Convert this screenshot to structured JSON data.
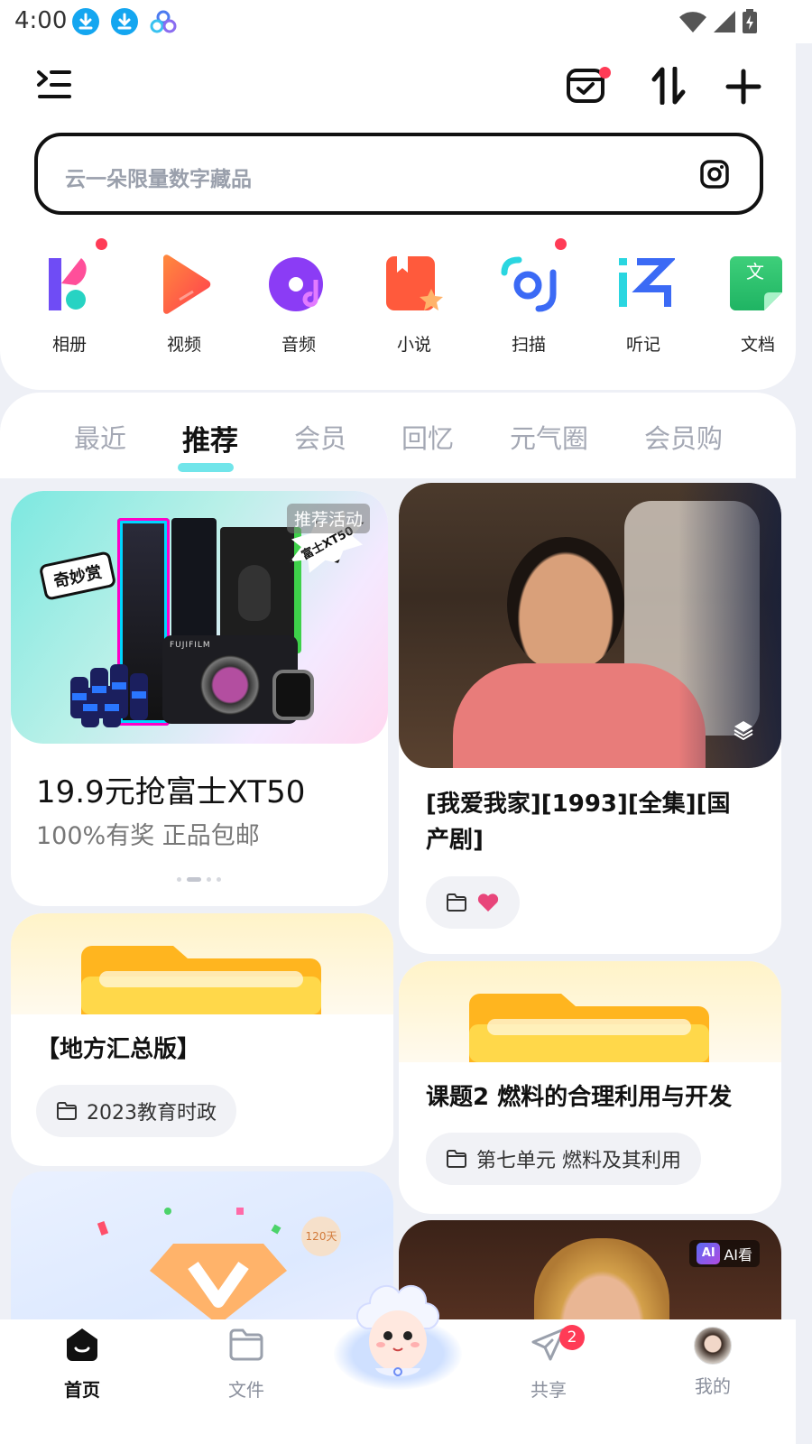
{
  "status_bar": {
    "time": "4:00"
  },
  "search": {
    "placeholder": "云一朵限量数字藏品"
  },
  "apps": [
    {
      "label": "相册",
      "icon": "photo-album-icon",
      "dot": true
    },
    {
      "label": "视频",
      "icon": "video-play-icon",
      "dot": false
    },
    {
      "label": "音频",
      "icon": "audio-disc-icon",
      "dot": false
    },
    {
      "label": "小说",
      "icon": "novel-book-icon",
      "dot": false
    },
    {
      "label": "扫描",
      "icon": "scan-icon",
      "dot": true
    },
    {
      "label": "听记",
      "icon": "listen-record-icon",
      "dot": false
    },
    {
      "label": "文档",
      "icon": "document-icon",
      "dot": false
    }
  ],
  "tabs": [
    "最近",
    "推荐",
    "会员",
    "回忆",
    "元气圈",
    "会员购"
  ],
  "active_tab": "推荐",
  "cards": {
    "promo": {
      "badge": "推荐活动",
      "sticker_left": "奇妙赏",
      "sticker_right": "富士XT50",
      "product_brand": "FUJIFILM",
      "title": "19.9元抢富士XT50",
      "subtitle": "100%有奖 正品包邮"
    },
    "video": {
      "title": "[我爱我家][1993][全集][国产剧]"
    },
    "folder1": {
      "title": "【地方汇总版】",
      "chip": "2023教育时政"
    },
    "folder2": {
      "title": "课题2 燃料的合理利用与开发",
      "chip": "第七单元 燃料及其利用"
    },
    "vip": {
      "tag": "120天"
    },
    "clip": {
      "ai_badge": "AI看"
    }
  },
  "nav": [
    {
      "label": "首页",
      "icon": "home-icon",
      "active": true
    },
    {
      "label": "文件",
      "icon": "folder-icon",
      "active": false
    },
    {
      "label": "共享",
      "icon": "share-send-icon",
      "active": false,
      "badge": "2"
    },
    {
      "label": "我的",
      "icon": "avatar",
      "active": false
    }
  ],
  "colors": {
    "accent_cyan": "#58e0e6",
    "badge_red": "#ff3b56",
    "like_pink": "#e8457a"
  }
}
